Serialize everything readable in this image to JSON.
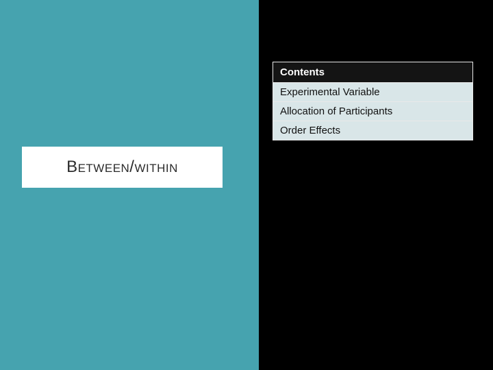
{
  "title": "Between/within",
  "contents": {
    "header": "Contents",
    "items": [
      "Experimental Variable",
      "Allocation of Participants",
      "Order Effects"
    ]
  }
}
